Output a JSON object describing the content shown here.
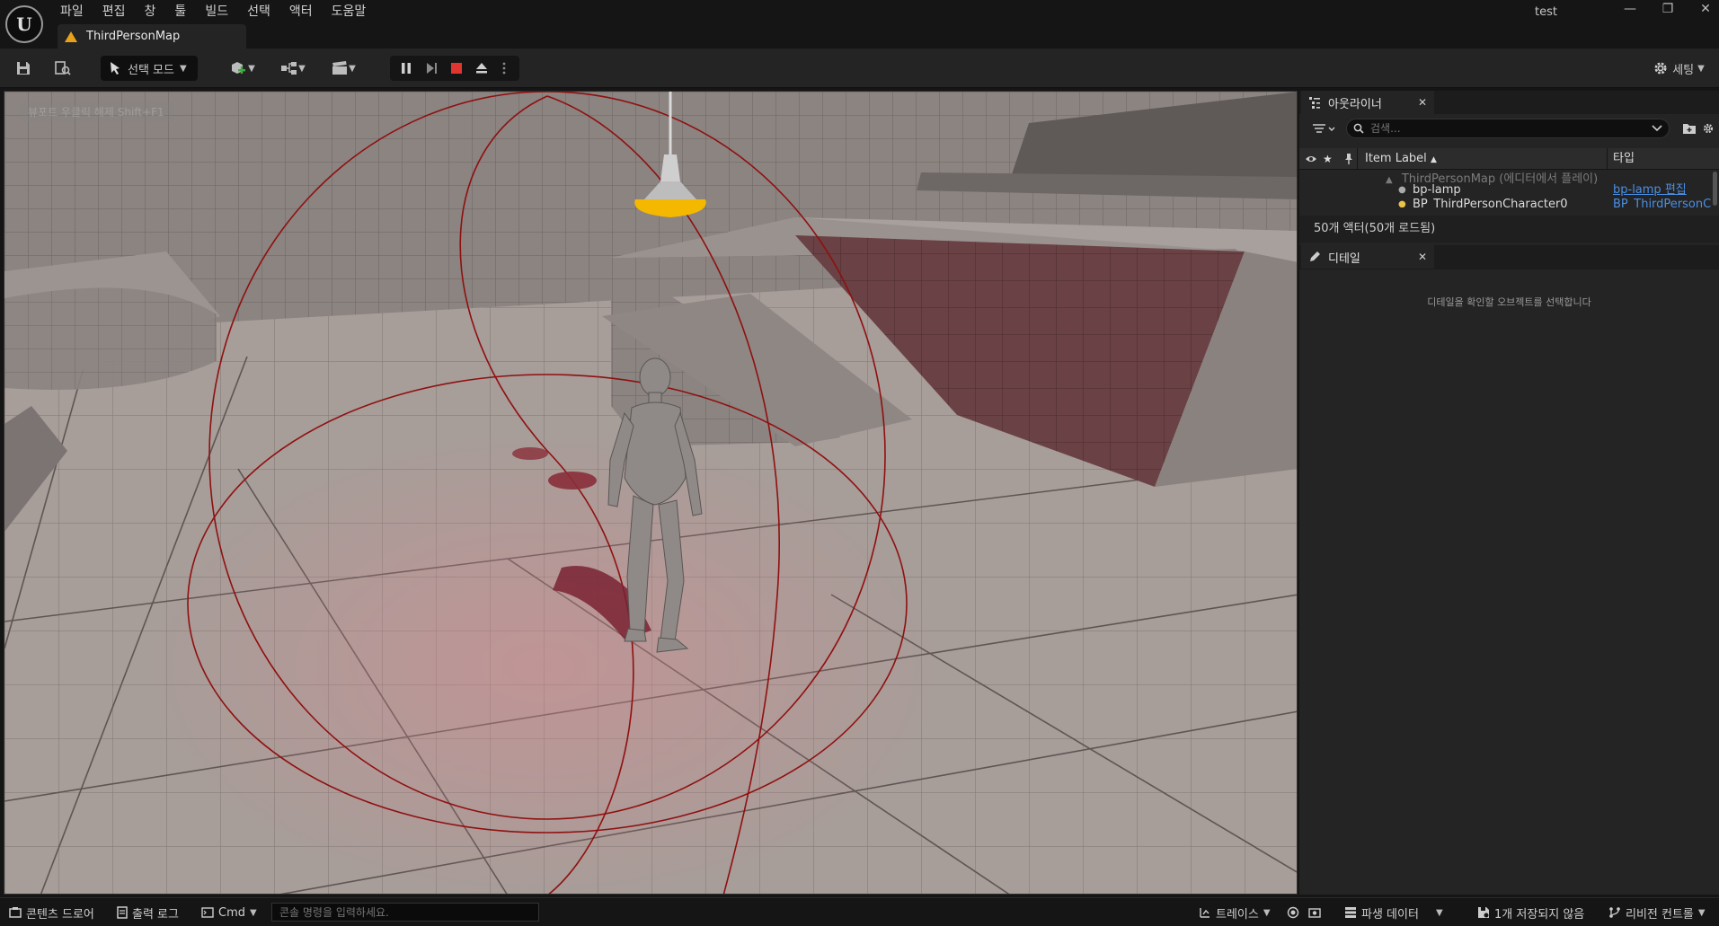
{
  "app": {
    "logo_letter": "U",
    "window_title": "test"
  },
  "menu": [
    "파일",
    "편집",
    "창",
    "툴",
    "빌드",
    "선택",
    "액터",
    "도움말"
  ],
  "tabs": {
    "map_tab": "ThirdPersonMap"
  },
  "window_controls": {
    "minimize": "—",
    "restore": "❐",
    "close": "✕"
  },
  "toolbar": {
    "mode_label": "선택 모드",
    "settings_label": "세팅"
  },
  "viewport": {
    "hint": "뷰포트 우클릭 해제 Shift+F1"
  },
  "outliner": {
    "title": "아웃라이너",
    "search_placeholder": "검색...",
    "columns": {
      "label": "Item Label",
      "type": "타입"
    },
    "map_row": "ThirdPersonMap (에디터에서 플레이)",
    "rows": [
      {
        "label": "bp-lamp",
        "type": "bp-lamp 편집"
      },
      {
        "label": "BP_ThirdPersonCharacter0",
        "type": "BP_ThirdPersonC"
      }
    ],
    "actor_count": "50개 액터(50개 로드됨)"
  },
  "details": {
    "title": "디테일",
    "empty_message": "디테일을 확인할 오브젝트를 선택합니다"
  },
  "statusbar": {
    "content_drawer": "콘텐츠 드로어",
    "output_log": "출력 로그",
    "cmd": "Cmd",
    "console_placeholder": "콘솔 명령을 입력하세요.",
    "trace": "트레이스",
    "derived_data": "파생 데이터",
    "unsaved": "1개 저장되지 않음",
    "revision_control": "리비전 컨트롤"
  },
  "colors": {
    "accent_warning": "#e8a21a",
    "stop": "#e0362f",
    "link": "#4a8fe6",
    "light_radius": "#8f1010",
    "lamp_shade": "#f5b800"
  }
}
